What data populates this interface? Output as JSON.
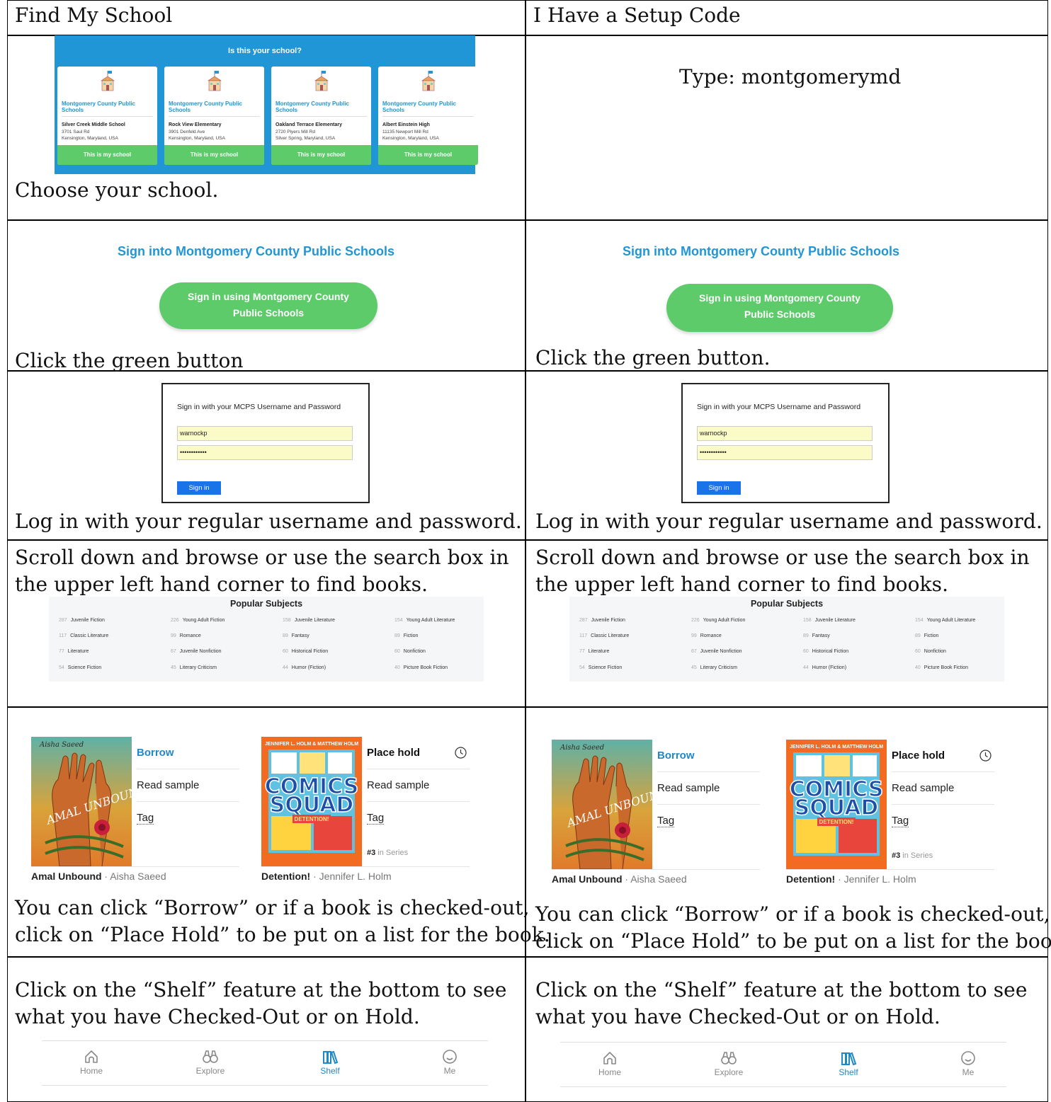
{
  "headers": {
    "left": "Find My School",
    "right": "I Have a Setup Code"
  },
  "row1": {
    "left": {
      "prompt": "Is this your school?",
      "schools": [
        {
          "org": "Montgomery County Public Schools",
          "name": "Silver Creek Middle School",
          "addr1": "3701 Saul Rd",
          "addr2": "Kensington, Maryland, USA",
          "button": "This is my school"
        },
        {
          "org": "Montgomery County Public Schools",
          "name": "Rock View Elementary",
          "addr1": "3901 Denfeld Ave",
          "addr2": "Kensington, Maryland, USA",
          "button": "This is my school"
        },
        {
          "org": "Montgomery County Public Schools",
          "name": "Oakland Terrace Elementary",
          "addr1": "2720 Plyers Mill Rd",
          "addr2": "Silver Spring, Maryland, USA",
          "button": "This is my school"
        },
        {
          "org": "Montgomery County Public Schools",
          "name": "Albert Einstein High",
          "addr1": "11135 Newport Mill Rd",
          "addr2": "Kensington, Maryland, USA",
          "button": "This is my school"
        }
      ],
      "caption": "Choose your school."
    },
    "right": {
      "text": "Type: montgomerymd"
    }
  },
  "row2": {
    "title": "Sign into Montgomery County Public Schools",
    "button_line1": "Sign in using Montgomery County",
    "button_line2": "Public Schools",
    "caption_left": "Click the green button",
    "caption_right": "Click the green button."
  },
  "row3": {
    "box_title": "Sign in with your MCPS Username and Password",
    "username": "warnockp",
    "password": "••••••••••••",
    "button": "Sign in",
    "caption": "Log in with your regular username and password."
  },
  "row4": {
    "line1": "Scroll down and browse or use the search box in",
    "line2": "the upper left hand corner to find books.",
    "subjects_title": "Popular Subjects",
    "subjects": [
      {
        "n": "287",
        "label": "Juvenile Fiction"
      },
      {
        "n": "226",
        "label": "Young Adult Fiction"
      },
      {
        "n": "158",
        "label": "Juvenile Literature"
      },
      {
        "n": "154",
        "label": "Young Adult Literature"
      },
      {
        "n": "117",
        "label": "Classic Literature"
      },
      {
        "n": "99",
        "label": "Romance"
      },
      {
        "n": "89",
        "label": "Fantasy"
      },
      {
        "n": "89",
        "label": "Fiction"
      },
      {
        "n": "77",
        "label": "Literature"
      },
      {
        "n": "67",
        "label": "Juvenile Nonfiction"
      },
      {
        "n": "60",
        "label": "Historical Fiction"
      },
      {
        "n": "60",
        "label": "Nonfiction"
      },
      {
        "n": "54",
        "label": "Science Fiction"
      },
      {
        "n": "45",
        "label": "Literary Criticism"
      },
      {
        "n": "44",
        "label": "Humor (Fiction)"
      },
      {
        "n": "40",
        "label": "Picture Book Fiction"
      }
    ]
  },
  "row5": {
    "book1": {
      "cover_author": "Aisha Saeed",
      "cover_title": "AMAL UNBOUND",
      "action1": "Borrow",
      "action2": "Read sample",
      "action3": "Tag",
      "title": "Amal Unbound",
      "sep": " · ",
      "author": "Aisha Saeed"
    },
    "book2": {
      "cover_top": "JENNIFER L. HOLM & MATTHEW HOLM",
      "cover_title1": "COMICS",
      "cover_title2": "SQUAD",
      "cover_sub": "DETENTION!",
      "action1": "Place hold",
      "action2": "Read sample",
      "action3": "Tag",
      "series_num": "#3",
      "series_text": " in Series",
      "title": "Detention!",
      "sep": " · ",
      "author": "Jennifer L. Holm"
    },
    "line1": "You can click “Borrow” or if a book is checked-out,",
    "line2": "click on “Place Hold” to be put on a list for the book."
  },
  "row6": {
    "line1": "Click on the “Shelf” feature at the bottom to see",
    "line2": "what you have Checked-Out or on Hold.",
    "nav": [
      "Home",
      "Explore",
      "Shelf",
      "Me"
    ]
  },
  "colors": {
    "brand_blue": "#2196d6",
    "button_green": "#5dcb6a",
    "link_blue": "#1e88c8",
    "signin_blue": "#1a73e8"
  }
}
